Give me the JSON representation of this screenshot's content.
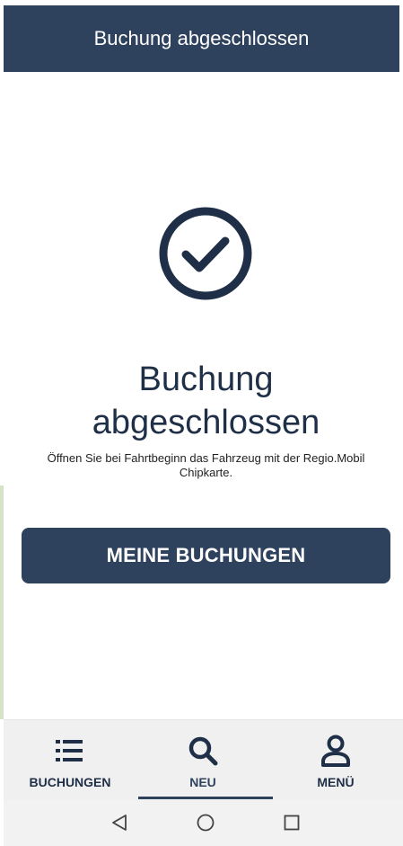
{
  "header": {
    "title": "Buchung abgeschlossen"
  },
  "main": {
    "title_line1": "Buchung",
    "title_line2": "abgeschlossen",
    "message_line1": "Öffnen Sie bei Fahrtbeginn das Fahrzeug mit der Regio.Mobil",
    "message_line2": "Chipkarte.",
    "status_icon": "check-circle-icon",
    "primary_button_label": "MEINE BUCHUNGEN"
  },
  "bottom_nav": {
    "items": [
      {
        "label": "BUCHUNGEN",
        "icon": "list-icon",
        "active": false
      },
      {
        "label": "NEU",
        "icon": "search-icon",
        "active": true
      },
      {
        "label": "MENÜ",
        "icon": "person-icon",
        "active": false
      }
    ]
  },
  "system_nav": {
    "buttons": [
      "back-icon",
      "home-icon",
      "recents-icon"
    ]
  },
  "colors": {
    "brand": "#2f425d",
    "text_dark": "#1f2f47",
    "nav_background": "#f0f0f0"
  }
}
